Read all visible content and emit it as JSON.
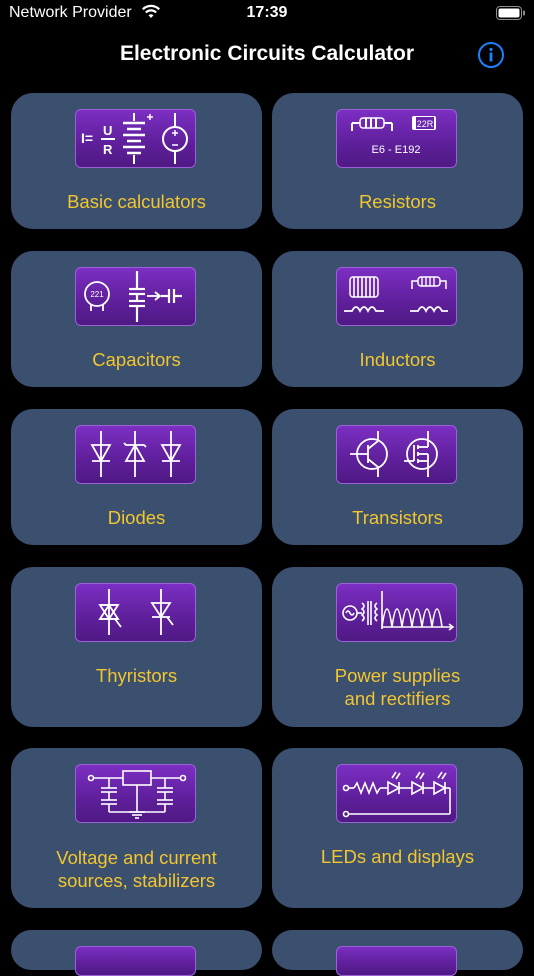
{
  "status_bar": {
    "carrier": "Network Provider",
    "time": "17:39"
  },
  "header": {
    "title": "Electronic Circuits Calculator",
    "info_icon": "info-icon"
  },
  "icon_texts": {
    "basic_formula_top": "U",
    "basic_formula_lhs": "I=",
    "basic_formula_bottom": "R",
    "resistor_series": "E6 - E192",
    "resistor_code": "22R",
    "capacitor_code": "221"
  },
  "tiles": [
    {
      "label": "Basic calculators"
    },
    {
      "label": "Resistors"
    },
    {
      "label": "Capacitors"
    },
    {
      "label": "Inductors"
    },
    {
      "label": "Diodes"
    },
    {
      "label": "Transistors"
    },
    {
      "label": "Thyristors"
    },
    {
      "label_line1": "Power supplies",
      "label_line2": "and rectifiers"
    },
    {
      "label_line1": "Voltage and current",
      "label_line2": "sources, stabilizers"
    },
    {
      "label": "LEDs and displays"
    }
  ],
  "colors": {
    "tile_bg": "#3b4f6f",
    "label": "#f2c62f",
    "icon_bg": "#6a24ad",
    "accent": "#1a82ff"
  }
}
